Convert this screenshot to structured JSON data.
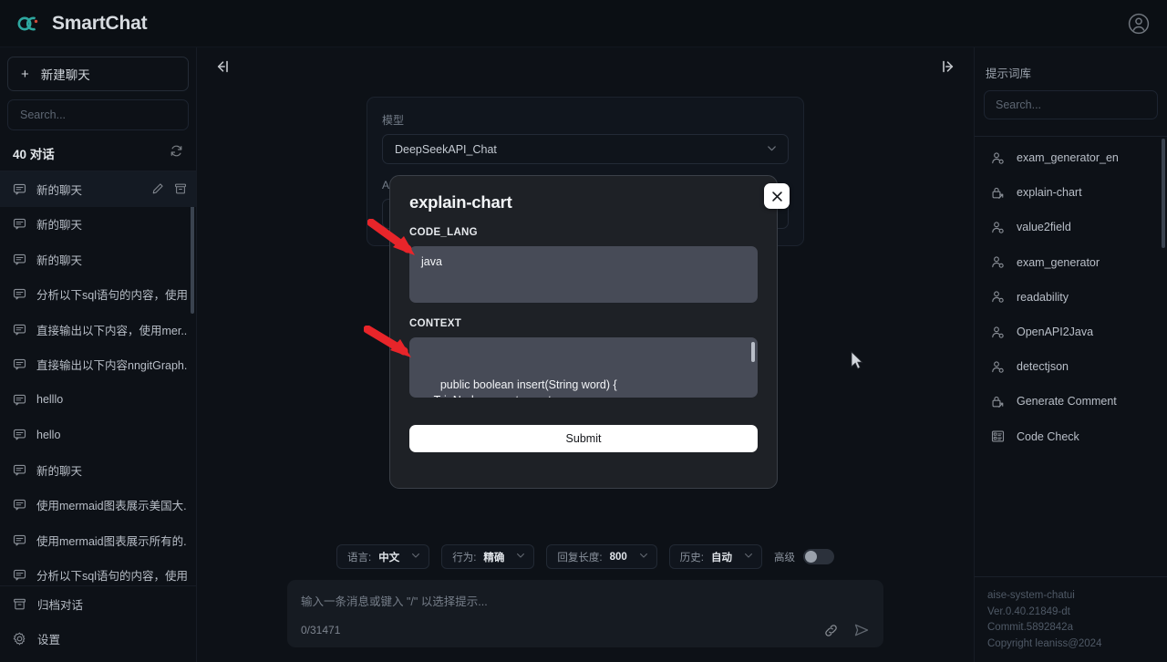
{
  "app": {
    "brand": "SmartChat",
    "logo_icon": "infinity-logo-icon",
    "avatar_icon": "user-avatar-icon"
  },
  "sidebar": {
    "new_chat_label": "新建聊天",
    "new_chat_icon": "plus-icon",
    "search_placeholder": "Search...",
    "conversation_count_label": "40 对话",
    "refresh_icon": "refresh-icon",
    "item_icon": "chat-bubble-icon",
    "edit_icon": "pencil-icon",
    "archive_icon": "archive-box-icon",
    "conversations": [
      {
        "label": "新的聊天",
        "active": true
      },
      {
        "label": "新的聊天",
        "active": false
      },
      {
        "label": "新的聊天",
        "active": false
      },
      {
        "label": "分析以下sql语句的内容，使用...",
        "active": false
      },
      {
        "label": "直接输出以下内容，使用mer...",
        "active": false
      },
      {
        "label": "直接输出以下内容nngitGraph...",
        "active": false
      },
      {
        "label": "helllo",
        "active": false
      },
      {
        "label": "hello",
        "active": false
      },
      {
        "label": "新的聊天",
        "active": false
      },
      {
        "label": "使用mermaid图表展示美国大...",
        "active": false
      },
      {
        "label": "使用mermaid图表展示所有的...",
        "active": false
      },
      {
        "label": "分析以下sql语句的内容，使用...",
        "active": false
      }
    ],
    "bottom_items": [
      {
        "label": "归档对话",
        "icon": "archive-box-icon"
      },
      {
        "label": "设置",
        "icon": "gear-icon"
      }
    ]
  },
  "center": {
    "collapse_left_icon": "collapse-left-icon",
    "collapse_right_icon": "collapse-right-icon",
    "model_label": "模型",
    "model_value": "DeepSeekAPI_Chat",
    "assistant_label": "AI助理",
    "chevron_icon": "chevron-down-icon"
  },
  "options": [
    {
      "key": "语言:",
      "value": "中文"
    },
    {
      "key": "行为:",
      "value": "精确"
    },
    {
      "key": "回复长度:",
      "value": "800"
    },
    {
      "key": "历史:",
      "value": "自动"
    }
  ],
  "advanced": {
    "label": "高级",
    "enabled": false
  },
  "composer": {
    "placeholder": "输入一条消息或键入 \"/\" 以选择提示...",
    "counter": "0/31471",
    "attach_icon": "link-icon",
    "send_icon": "send-paper-plane-icon"
  },
  "right_panel": {
    "title": "提示词库",
    "search_placeholder": "Search...",
    "items": [
      {
        "label": "exam_generator_en",
        "icon": "user-gear-icon"
      },
      {
        "label": "explain-chart",
        "icon": "lock-share-icon"
      },
      {
        "label": "value2field",
        "icon": "user-gear-icon"
      },
      {
        "label": "exam_generator",
        "icon": "user-gear-icon"
      },
      {
        "label": "readability",
        "icon": "user-gear-icon"
      },
      {
        "label": "OpenAPI2Java",
        "icon": "user-gear-icon"
      },
      {
        "label": "detectjson",
        "icon": "user-gear-icon"
      },
      {
        "label": "Generate Comment",
        "icon": "lock-share-icon"
      },
      {
        "label": "Code Check",
        "icon": "list-panel-icon"
      }
    ],
    "footer": {
      "line1": "aise-system-chatui",
      "line2": "Ver.0.40.21849-dt",
      "line3": "Commit.5892842a",
      "line4": "Copyright leaniss@2024"
    }
  },
  "modal": {
    "title": "explain-chart",
    "close_icon": "close-icon",
    "field1_label": "CODE_LANG",
    "field1_value": "java",
    "field2_label": "CONTEXT",
    "field2_value": "public boolean insert(String word) {\n    TrieNode current = root;\n    for (char c : word.toCharArray()) {\n        // 不存在则创建一个新的节点",
    "submit_label": "Submit"
  },
  "colors": {
    "background": "#0d1117",
    "modal_bg": "#1e2126",
    "textarea_bg": "#474b57",
    "accent_white": "#ffffff",
    "annotation_red": "#e8252a",
    "brand_teal": "#2ea8a0"
  }
}
